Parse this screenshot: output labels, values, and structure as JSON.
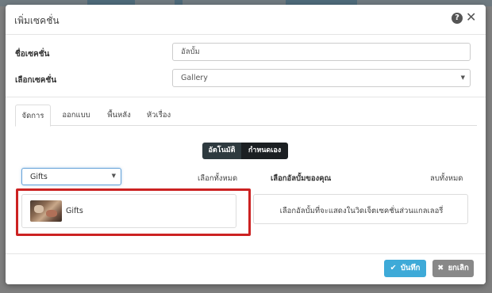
{
  "dialog": {
    "title": "เพิ่มเซคชั่น",
    "help_icon": "?",
    "close_icon": "✕"
  },
  "form": {
    "name_label": "ชื่อเซคชั่น",
    "name_value": "อัลบั้ม",
    "type_label": "เลือกเซคชั่น",
    "type_value": "Gallery"
  },
  "tabs": [
    {
      "label": "จัดการ",
      "active": true
    },
    {
      "label": "ออกแบบ",
      "active": false
    },
    {
      "label": "พื้นหลัง",
      "active": false
    },
    {
      "label": "หัวเรื่อง",
      "active": false
    }
  ],
  "mode_toggle": {
    "auto_label": "อัตโนมัติ",
    "manual_label": "กำหนดเอง"
  },
  "album_picker": {
    "filter_value": "Gifts",
    "select_all_label": "เลือกทั้งหมด",
    "your_albums_label": "เลือกอัลบั้มของคุณ",
    "remove_all_label": "ลบทั้งหมด",
    "items": [
      {
        "name": "Gifts",
        "thumb": "gifts-thumbnail"
      }
    ],
    "selected_hint": "เลือกอัลบั้มที่จะแสดงในวิดเจ็ตเซคชั่นส่วนแกลเลอรี่"
  },
  "footer": {
    "save_label": "บันทึก",
    "save_icon": "✔",
    "cancel_label": "ยกเลิก",
    "cancel_icon": "✖"
  },
  "colors": {
    "save_button": "#3eaad8",
    "cancel_button": "#888888",
    "toggle_dark": "#1b1f22",
    "highlight": "#cc2222"
  }
}
